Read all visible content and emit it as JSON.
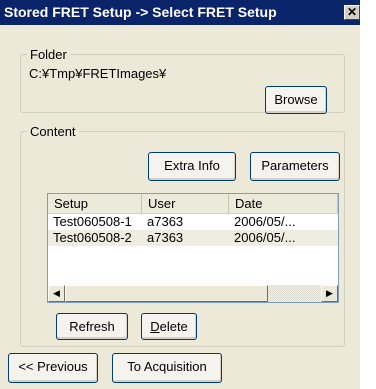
{
  "window": {
    "title": "Stored FRET Setup -> Select FRET Setup",
    "close_label": "✕"
  },
  "folder": {
    "legend": "Folder",
    "path": "C:¥Tmp¥FRETImages¥",
    "browse_label": "Browse"
  },
  "content": {
    "legend": "Content",
    "extra_info_label": "Extra Info",
    "parameters_label": "Parameters",
    "table": {
      "columns": [
        "Setup",
        "User",
        "Date"
      ],
      "rows": [
        [
          "Test060508-1",
          "a7363",
          "2006/05/..."
        ],
        [
          "Test060508-2",
          "a7363",
          "2006/05/..."
        ]
      ]
    },
    "refresh_label": "Refresh",
    "delete_prefix": "D",
    "delete_rest": "elete"
  },
  "footer": {
    "previous_label": "<< Previous",
    "acquisition_label": "To Acquisition"
  }
}
